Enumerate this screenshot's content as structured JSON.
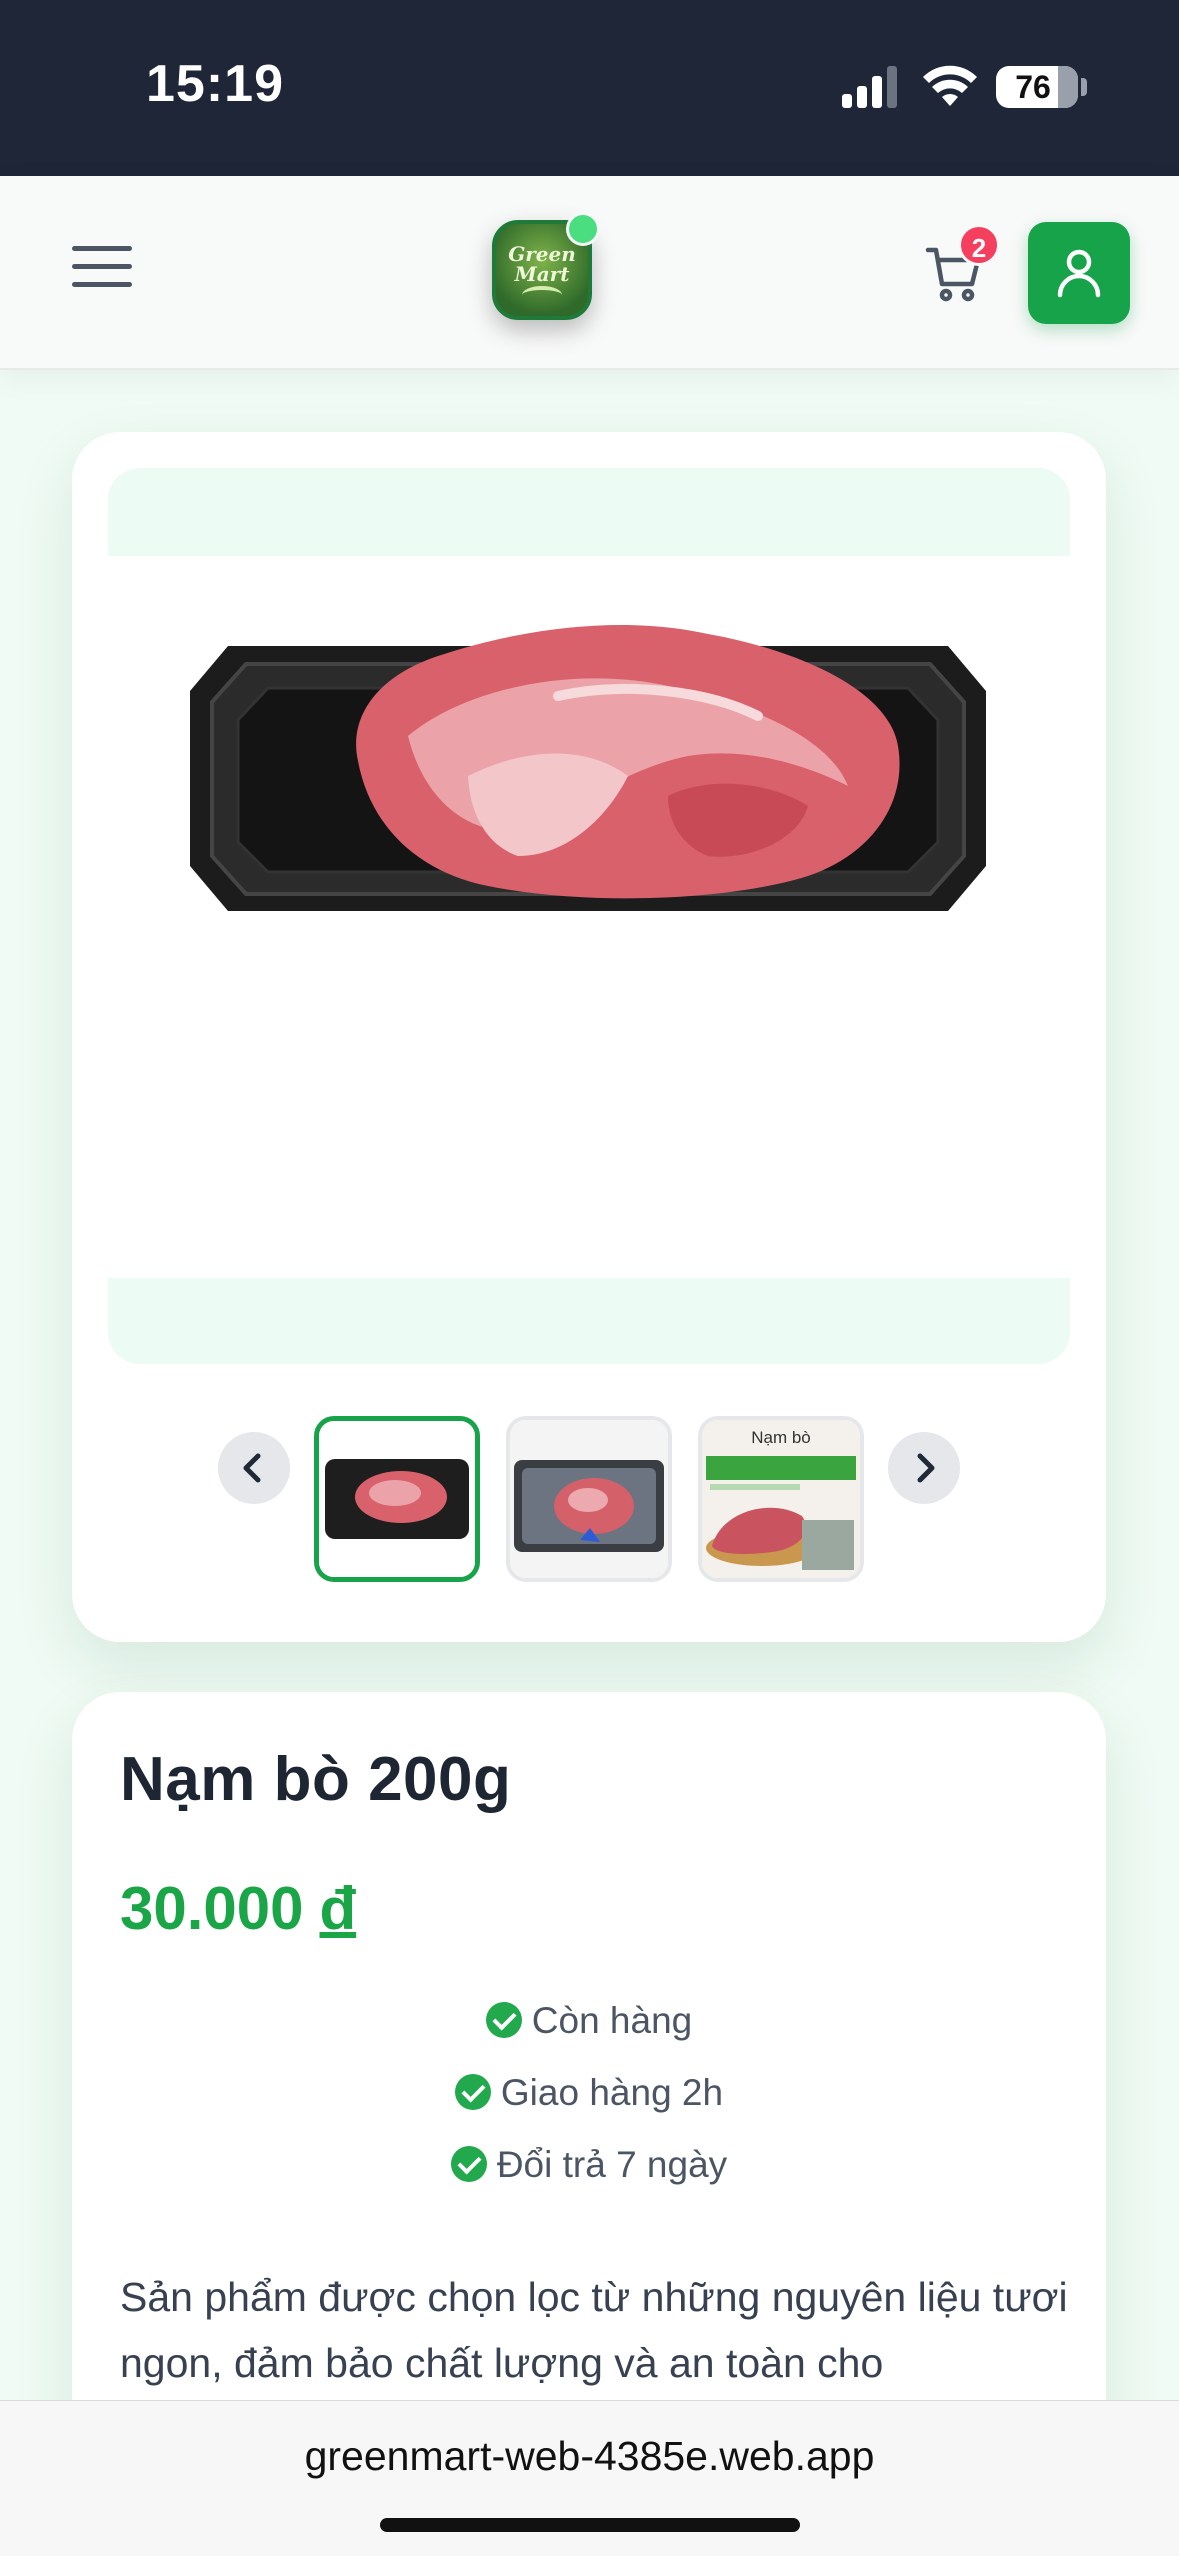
{
  "status_bar": {
    "time": "15:19",
    "battery": "76"
  },
  "header": {
    "logo_text_line1": "Green",
    "logo_text_line2": "Mart",
    "cart_count": "2",
    "icons": [
      "menu-icon",
      "cart-icon",
      "user-icon"
    ]
  },
  "gallery": {
    "thumbnails": [
      {
        "active": true
      },
      {
        "active": false
      },
      {
        "title": "Nạm bò",
        "active": false
      }
    ]
  },
  "product": {
    "name": "Nạm bò 200g",
    "price": "30.000",
    "currency": "đ",
    "features": [
      "Còn hàng",
      "Giao hàng 2h",
      "Đổi trả 7 ngày"
    ],
    "description": "Sản phẩm được chọn lọc từ những nguyên liệu tươi ngon, đảm bảo chất lượng và an toàn cho"
  },
  "browser": {
    "url": "greenmart-web-4385e.web.app"
  },
  "colors": {
    "brand_green": "#16a34a",
    "price_green": "#1aa546",
    "badge_red": "#f43f5e",
    "status_bar_bg": "#1f2638"
  }
}
